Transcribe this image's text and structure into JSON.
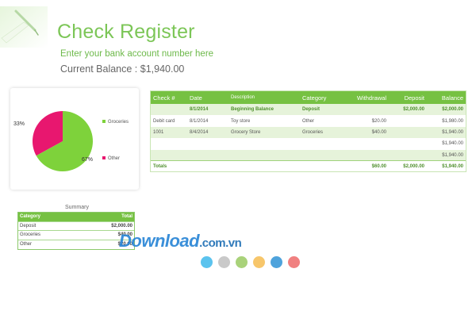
{
  "header": {
    "title": "Check Register",
    "account_placeholder": "Enter your bank account number here",
    "balance_label": "Current Balance : $1,940.00"
  },
  "register": {
    "columns": [
      "Check #",
      "Date",
      "Description",
      "Category",
      "Withdrawal",
      "Deposit",
      "Balance"
    ],
    "rows": [
      [
        "",
        "8/1/2014",
        "Beginning Balance",
        "Deposit",
        "",
        "$2,000.00",
        "$2,000.00"
      ],
      [
        "Debit card",
        "8/1/2014",
        "Toy store",
        "Other",
        "$20.00",
        "",
        "$1,980.00"
      ],
      [
        "1001",
        "8/4/2014",
        "Grocery Store",
        "Groceries",
        "$40.00",
        "",
        "$1,940.00"
      ],
      [
        "",
        "",
        "",
        "",
        "",
        "",
        "$1,940.00"
      ],
      [
        "",
        "",
        "",
        "",
        "",
        "",
        "$1,940.00"
      ]
    ],
    "totals": [
      "Totals",
      "",
      "",
      "",
      "$60.00",
      "$2,000.00",
      "$1,940.00"
    ]
  },
  "chart_data": {
    "type": "pie",
    "slices": [
      {
        "label": "Groceries",
        "value": 67,
        "display": "67%",
        "color": "#7ed23b"
      },
      {
        "label": "Other",
        "value": 33,
        "display": "33%",
        "color": "#e8176f"
      }
    ],
    "legend_placement": "right"
  },
  "summary": {
    "title": "Summary",
    "columns": [
      "Category",
      "Total"
    ],
    "rows": [
      [
        "Deposit",
        "$2,000.00"
      ],
      [
        "Groceries",
        "$40.00"
      ],
      [
        "Other",
        "$20.00"
      ]
    ]
  },
  "watermark": {
    "brand": "Download",
    "domain": ".com.vn"
  },
  "palette_dots": [
    "#5bc3ee",
    "#c9c9c9",
    "#a9d27a",
    "#f7c66b",
    "#4ea3dc",
    "#f08080"
  ]
}
